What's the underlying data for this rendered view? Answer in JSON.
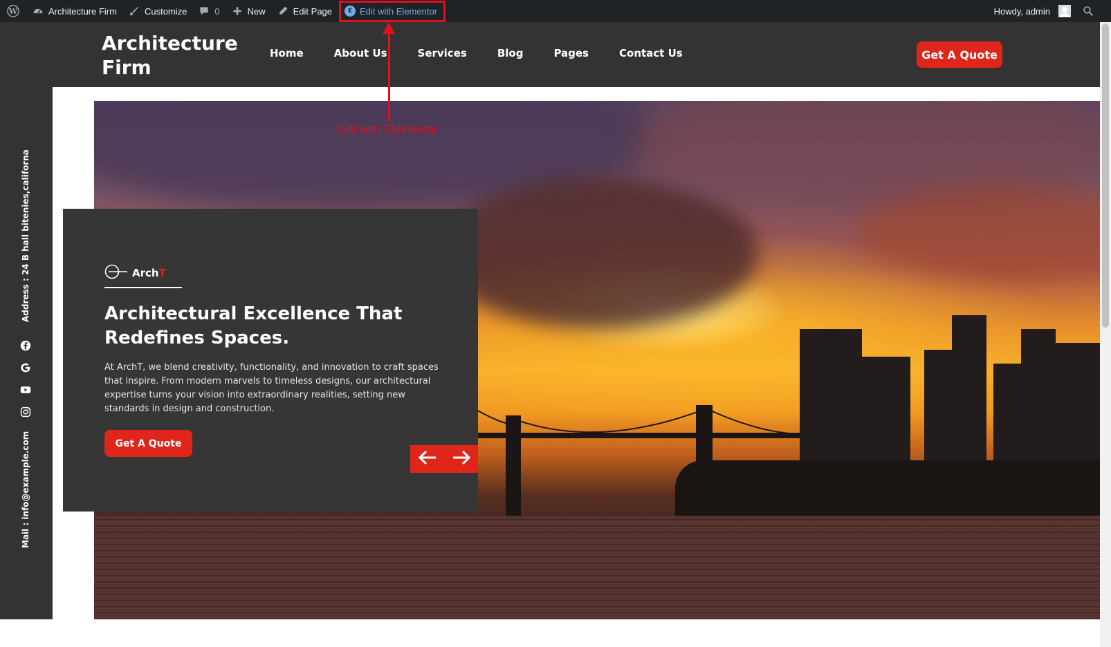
{
  "adminbar": {
    "wp_logo": "wordpress-icon",
    "site_name": "Architecture Firm",
    "customize": "Customize",
    "comments_count": "0",
    "new": "New",
    "edit_page": "Edit Page",
    "edit_with_elementor": "Edit with Elementor",
    "howdy": "Howdy, admin"
  },
  "header": {
    "site_title": "Architecture Firm",
    "nav": [
      "Home",
      "About Us",
      "Services",
      "Blog",
      "Pages",
      "Contact Us"
    ],
    "cta": "Get A Quote"
  },
  "sidebar": {
    "address": "Address : 24 B hall bitenies,californa",
    "mail": "Mail : info@example.com",
    "social": [
      "facebook-icon",
      "google-icon",
      "youtube-icon",
      "instagram-icon"
    ]
  },
  "slide": {
    "brand_main": "Arch",
    "brand_accent": "T",
    "title": "Architectural Excellence That Redefines Spaces.",
    "text": "At ArchT, we blend creativity, functionality, and innovation to craft spaces that inspire. From modern marvels to timeless designs, our architectural expertise turns your vision into extraordinary realities, setting new standards in design and construction.",
    "button": "Get A Quote"
  },
  "annotation": {
    "label": "Edit with Elementor"
  },
  "colors": {
    "accent": "#e0261b",
    "dark": "#333333",
    "adminbar": "#1d2327",
    "annotation": "#e0101d"
  }
}
